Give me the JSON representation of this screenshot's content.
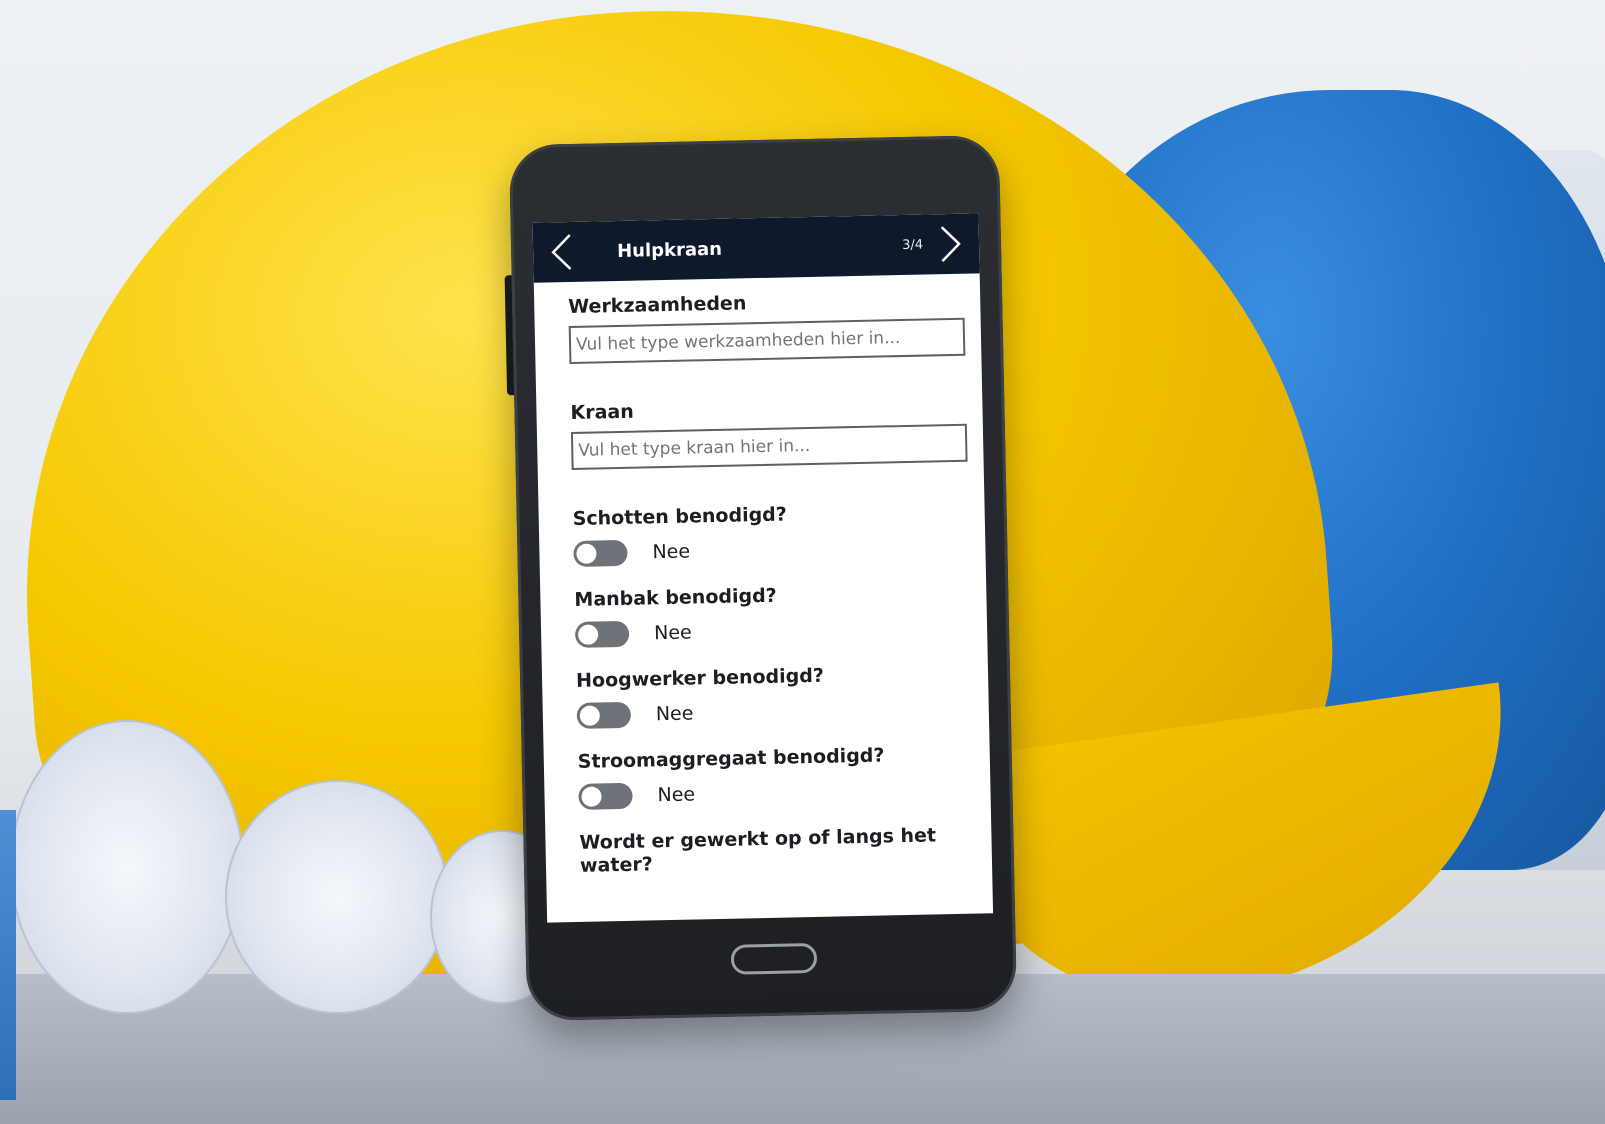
{
  "header": {
    "back_icon": "chevron-left-icon",
    "title": "Hulpkraan",
    "page_indicator": "3/4",
    "next_icon": "chevron-right-icon"
  },
  "fields": {
    "werkzaamheden": {
      "label": "Werkzaamheden",
      "value": "",
      "placeholder": "Vul het type werkzaamheden hier in..."
    },
    "kraan": {
      "label": "Kraan",
      "value": "",
      "placeholder": "Vul het type kraan hier in..."
    }
  },
  "toggles": [
    {
      "label": "Schotten benodigd?",
      "value": "Nee",
      "on": false
    },
    {
      "label": "Manbak benodigd?",
      "value": "Nee",
      "on": false
    },
    {
      "label": "Hoogwerker benodigd?",
      "value": "Nee",
      "on": false
    },
    {
      "label": "Stroomaggregaat benodigd?",
      "value": "Nee",
      "on": false
    }
  ],
  "last_question": "Wordt er gewerkt op of langs het water?",
  "colors": {
    "header_bg": "#0e1a2b",
    "toggle_off": "#6e7379"
  }
}
